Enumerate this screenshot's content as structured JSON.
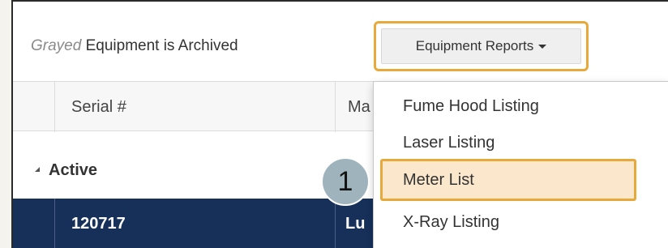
{
  "toolbar": {
    "note_emphasis": "Grayed",
    "note_rest": "Equipment is Archived",
    "reports_button_label": "Equipment Reports"
  },
  "columns": [
    "Serial #",
    "Ma"
  ],
  "group": {
    "label": "Active"
  },
  "row": {
    "serial": "120717",
    "manufacturer_partial": "Lu"
  },
  "menu": {
    "items": [
      "Fume Hood Listing",
      "Laser Listing",
      "Meter List",
      "X-Ray Listing"
    ],
    "highlighted_index": 2
  },
  "step": {
    "number": "1"
  },
  "colors": {
    "highlight_border": "#e7a93a",
    "highlight_fill": "#fbe8cc",
    "selected_row": "#16305a",
    "step_badge": "#9fb3bd"
  }
}
